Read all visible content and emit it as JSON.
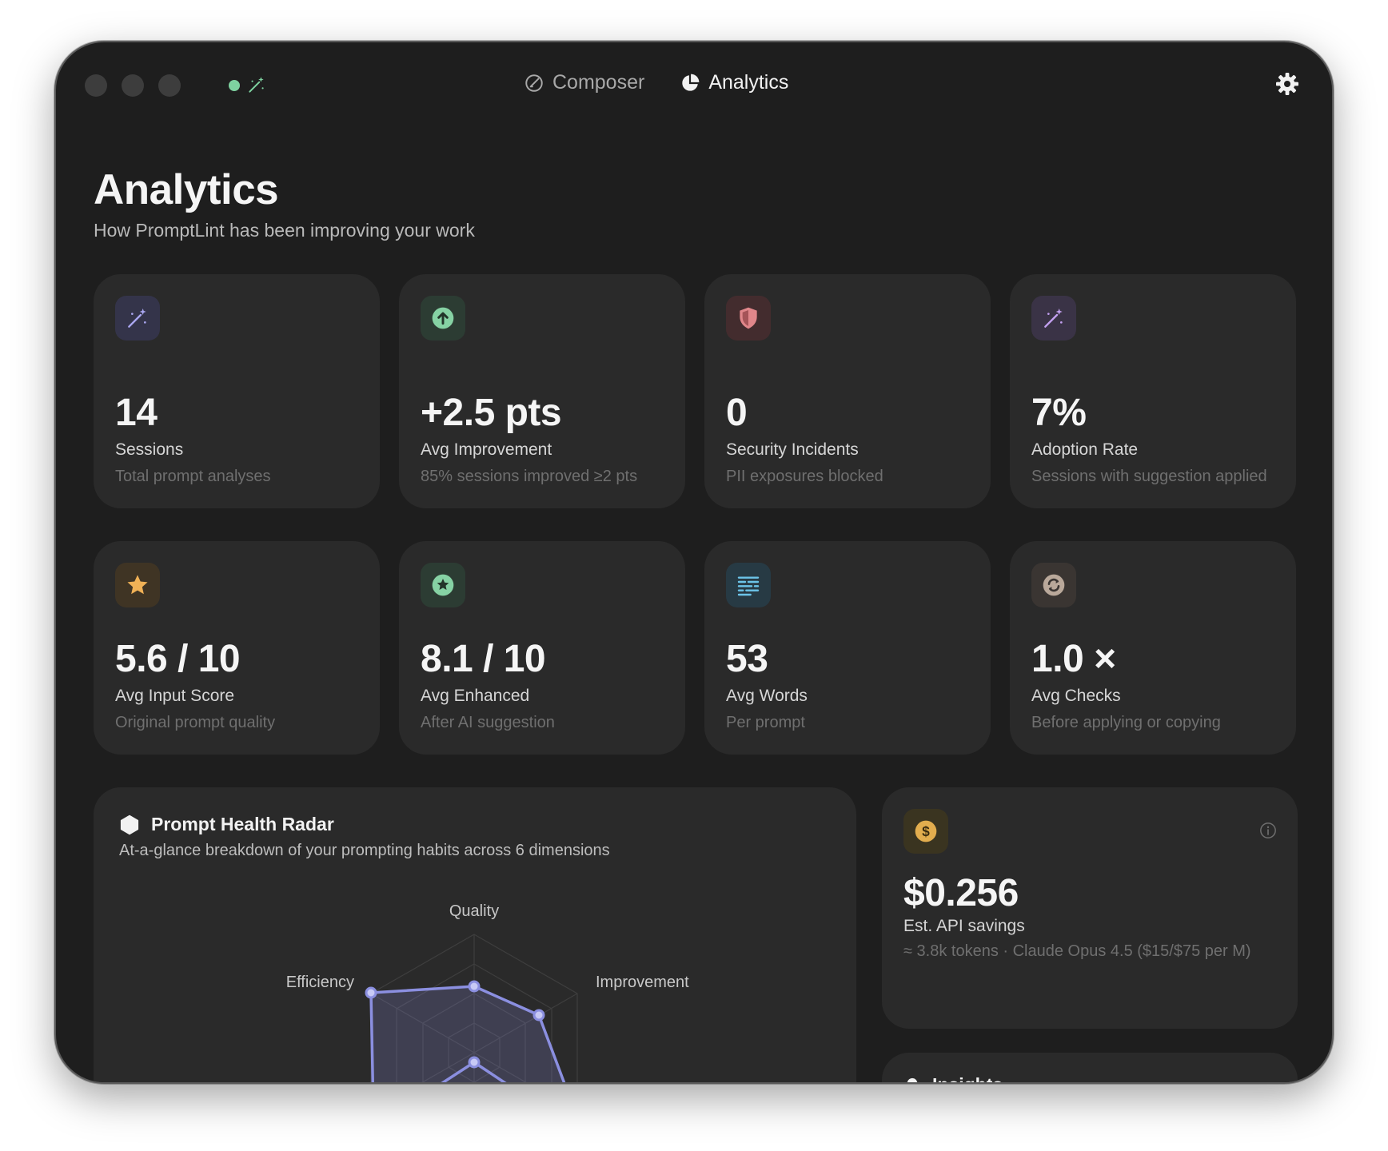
{
  "titlebar": {
    "nav_tabs": [
      {
        "label": "Composer",
        "icon": "composer-icon",
        "active": false
      },
      {
        "label": "Analytics",
        "icon": "pie-chart-icon",
        "active": true
      }
    ],
    "status_color": "#7ed2a0"
  },
  "header": {
    "title": "Analytics",
    "subtitle": "How PromptLint has been improving your work"
  },
  "stats": [
    {
      "icon": "magic-wand-icon",
      "value": "14",
      "label": "Sessions",
      "description": "Total prompt analyses"
    },
    {
      "icon": "arrow-up-circle-icon",
      "value": "+2.5 pts",
      "label": "Avg Improvement",
      "description": "85% sessions improved ≥2 pts"
    },
    {
      "icon": "shield-icon",
      "value": "0",
      "label": "Security Incidents",
      "description": "PII exposures blocked"
    },
    {
      "icon": "magic-wand-icon",
      "value": "7%",
      "label": "Adoption Rate",
      "description": "Sessions with suggestion applied"
    },
    {
      "icon": "star-icon",
      "value": "5.6 / 10",
      "label": "Avg Input Score",
      "description": "Original prompt quality"
    },
    {
      "icon": "star-circle-icon",
      "value": "8.1 / 10",
      "label": "Avg Enhanced",
      "description": "After AI suggestion"
    },
    {
      "icon": "text-lines-icon",
      "value": "53",
      "label": "Avg Words",
      "description": "Per prompt"
    },
    {
      "icon": "refresh-icon",
      "value": "1.0 ×",
      "label": "Avg Checks",
      "description": "Before applying or copying"
    }
  ],
  "radar": {
    "title": "Prompt Health Radar",
    "subtitle": "At-a-glance breakdown of your prompting habits across 6 dimensions",
    "axis_labels": {
      "quality": "Quality",
      "improvement": "Improvement",
      "efficiency": "Efficiency"
    },
    "accent": "#8b8fe0"
  },
  "savings": {
    "value": "$0.256",
    "label": "Est. API savings",
    "description": "≈ 3.8k tokens · Claude Opus 4.5 ($15/$75 per M)",
    "accent": "#d8a94a"
  },
  "insights": {
    "title": "Insights"
  }
}
